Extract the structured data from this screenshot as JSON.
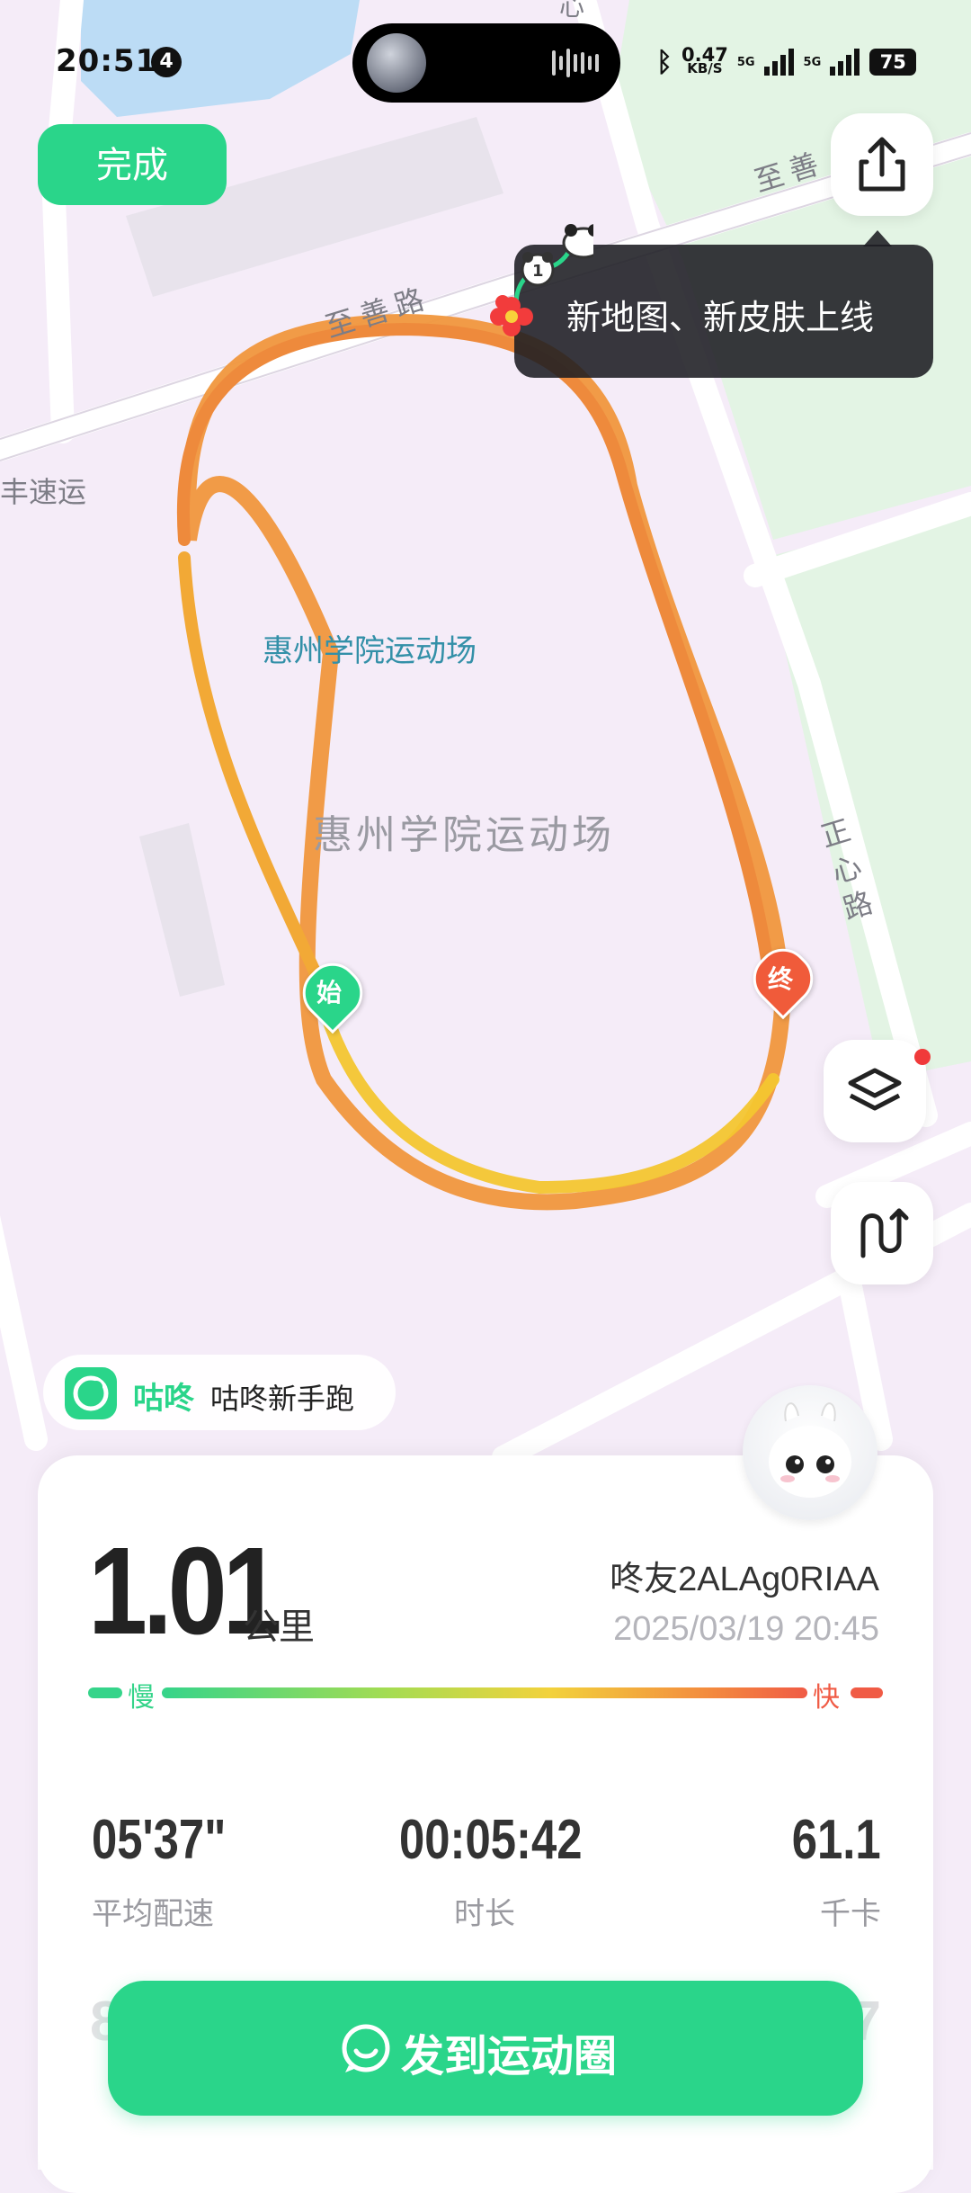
{
  "status_bar": {
    "time": "20:51",
    "notification_count": "4",
    "net_speed": "0.47",
    "net_unit": "KB/S",
    "signal1": "5G",
    "signal2": "5G",
    "battery": "75"
  },
  "header": {
    "done_label": "完成",
    "tooltip": "新地图、新皮肤上线"
  },
  "map": {
    "labels": {
      "road_top": "至善路",
      "road_top_right": "至善",
      "road_right": "正心路",
      "road_left": "丰速运",
      "road_top_center": "心",
      "poi_stadium_blue": "惠州学院运动场",
      "poi_stadium_gray": "惠州学院运动场"
    },
    "start_marker": "始",
    "end_marker": "终",
    "route_color_slow": "#f2c230",
    "route_color_fast": "#ee8a3c"
  },
  "brand": {
    "name": "咕咚",
    "subtitle": "咕咚新手跑"
  },
  "summary": {
    "distance": "1.01",
    "distance_unit": "公里",
    "user": "咚友2ALAg0RIAA",
    "date": "2025/03/19 20:45",
    "pace_slow": "慢",
    "pace_fast": "快",
    "stats": [
      {
        "value": "05'37\"",
        "label": "平均配速"
      },
      {
        "value": "00:05:42",
        "label": "时长"
      },
      {
        "value": "61.1",
        "label": "千卡"
      }
    ],
    "row2_left_partial": "8",
    "row2_right_partial": "7"
  },
  "actions": {
    "post_label": "发到运动圈"
  }
}
